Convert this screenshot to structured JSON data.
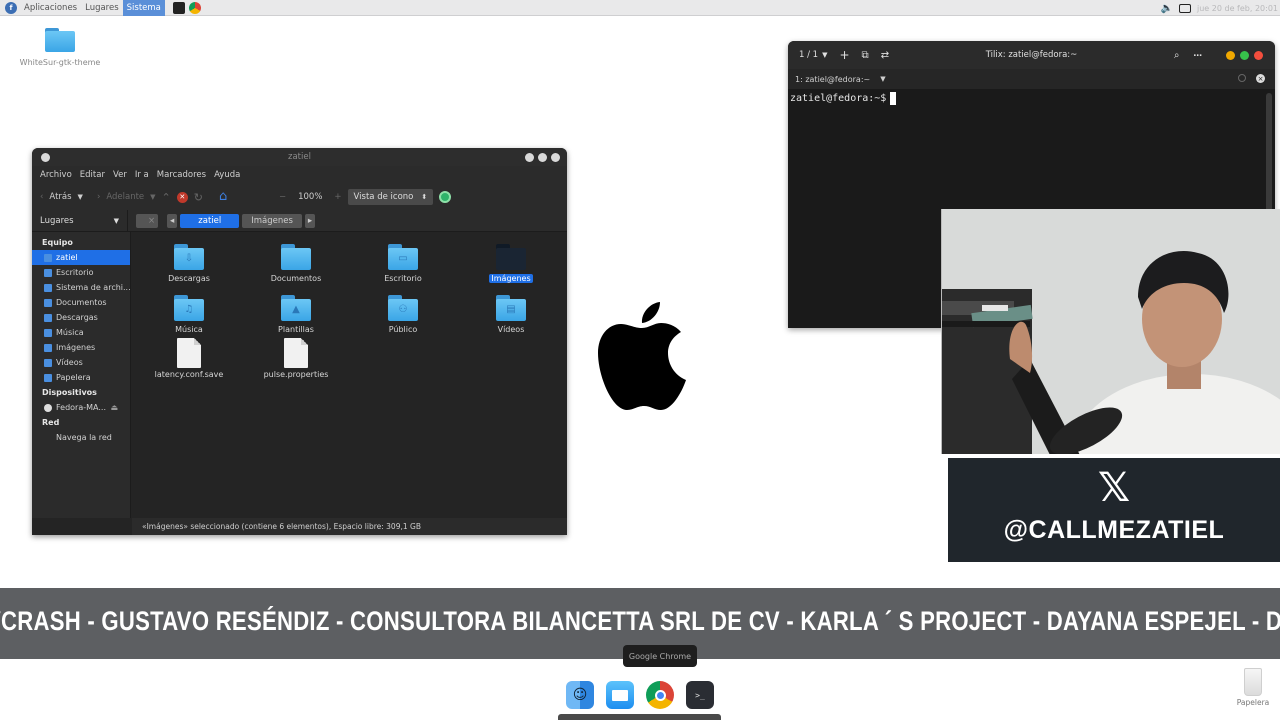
{
  "top_panel": {
    "menu": [
      "Aplicaciones",
      "Lugares",
      "Sistema"
    ],
    "clock": "jue 20 de feb, 20:01"
  },
  "desktop": {
    "icon_label": "WhiteSur-gtk-theme"
  },
  "file_manager": {
    "title": "zatiel",
    "menu": [
      "Archivo",
      "Editar",
      "Ver",
      "Ir a",
      "Marcadores",
      "Ayuda"
    ],
    "toolbar": {
      "back": "Atrás",
      "forward": "Adelante",
      "zoom": "100%",
      "view_mode": "Vista de icono"
    },
    "places_select": "Lugares",
    "breadcrumbs": [
      "zatiel",
      "Imágenes"
    ],
    "sidebar": {
      "sections": [
        {
          "title": "Equipo",
          "items": [
            "zatiel",
            "Escritorio",
            "Sistema de archi...",
            "Documentos",
            "Descargas",
            "Música",
            "Imágenes",
            "Vídeos",
            "Papelera"
          ]
        },
        {
          "title": "Dispositivos",
          "items": [
            "Fedora-MA..."
          ]
        },
        {
          "title": "Red",
          "items": [
            "Navega la red"
          ]
        }
      ],
      "selected": "zatiel"
    },
    "items": [
      {
        "name": "Descargas",
        "kind": "folder",
        "glyph": "⇩"
      },
      {
        "name": "Documentos",
        "kind": "folder",
        "glyph": ""
      },
      {
        "name": "Escritorio",
        "kind": "folder",
        "glyph": "▭"
      },
      {
        "name": "Imágenes",
        "kind": "folder-selected",
        "glyph": ""
      },
      {
        "name": "Música",
        "kind": "folder",
        "glyph": "♫"
      },
      {
        "name": "Plantillas",
        "kind": "folder",
        "glyph": "▲"
      },
      {
        "name": "Público",
        "kind": "folder",
        "glyph": "⚇"
      },
      {
        "name": "Vídeos",
        "kind": "folder",
        "glyph": "▤"
      },
      {
        "name": "latency.conf.save",
        "kind": "file",
        "glyph": ""
      },
      {
        "name": "pulse.properties",
        "kind": "file",
        "glyph": ""
      }
    ],
    "status": "«Imágenes» seleccionado (contiene 6 elementos), Espacio libre: 309,1 GB"
  },
  "terminal": {
    "session_counter": "1 / 1",
    "title": "Tilix: zatiel@fedora:~",
    "tab_label": "1: zatiel@fedora:~",
    "prompt": "zatiel@fedora:~$"
  },
  "x_card": {
    "logo": "𝕏",
    "handle": "@CALLMEZATIEL"
  },
  "ticker": {
    "text": "VCRASH - GUSTAVO RESÉNDIZ - CONSULTORA BILANCETTA SRL DE CV - KARLA  ´  S PROJECT - DAYANA ESPEJEL - DI-EM - ALFONSO LUNA"
  },
  "dock": {
    "tooltip": "Google Chrome",
    "apps": [
      "finder",
      "mail",
      "chrome",
      "terminal"
    ]
  },
  "trash": {
    "label": "Papelera"
  },
  "colors": {
    "accent_blue": "#1f6fe6",
    "fm_bg": "#242424",
    "ticker_bg": "#5d5f62",
    "x_card_bg": "#20262c"
  }
}
